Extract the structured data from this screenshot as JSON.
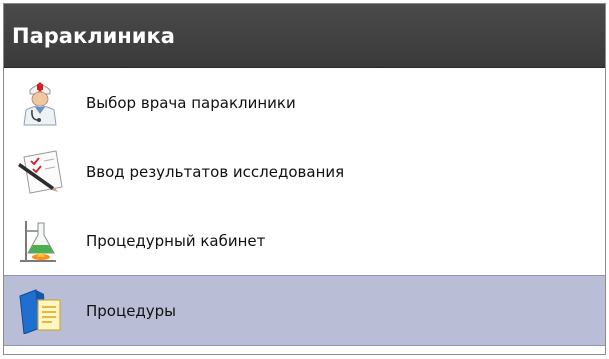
{
  "panel": {
    "title": "Параклиника",
    "items": [
      {
        "label": "Выбор врача параклиники",
        "icon": "doctor-icon",
        "selected": false
      },
      {
        "label": "Ввод результатов исследования",
        "icon": "document-pen-icon",
        "selected": false
      },
      {
        "label": "Процедурный кабинет",
        "icon": "lab-flask-icon",
        "selected": false
      },
      {
        "label": "Процедуры",
        "icon": "procedures-book-icon",
        "selected": true
      }
    ]
  },
  "colors": {
    "header_bg": "#3f3f3f",
    "header_text": "#ffffff",
    "selected_bg": "#b9bed6"
  }
}
